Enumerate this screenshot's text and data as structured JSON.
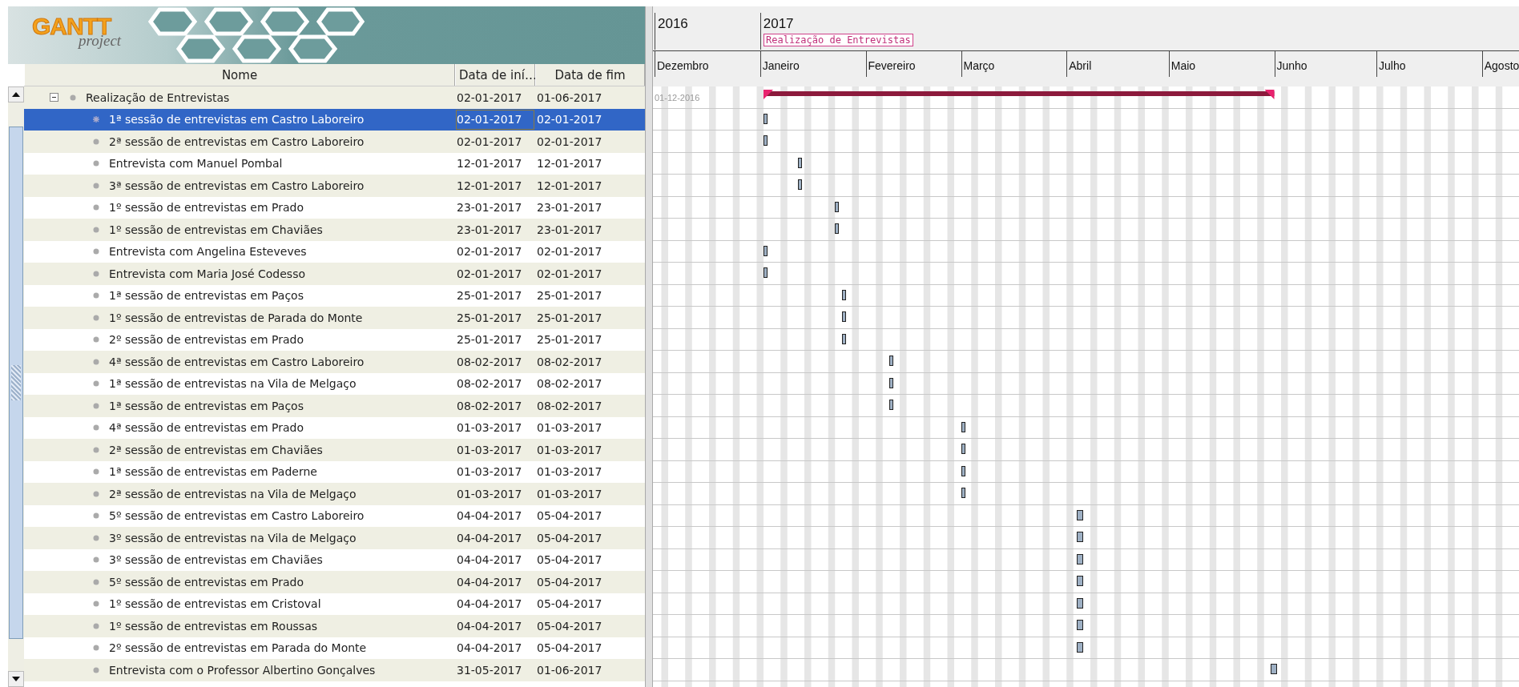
{
  "logo": {
    "wordmark": "GANTT",
    "subtitle": "project"
  },
  "table": {
    "columns": [
      "Nome",
      "Data de iní…",
      "Data de fim"
    ],
    "rows": [
      {
        "kind": "summary",
        "name": "Realização de Entrevistas",
        "start": "02-01-2017",
        "end": "01-06-2017",
        "selected": false,
        "expanded": true,
        "children": [
          {
            "kind": "task",
            "name": "1ª sessão de entrevistas em Castro Laboreiro",
            "start": "02-01-2017",
            "end": "02-01-2017",
            "selected": true
          },
          {
            "kind": "task",
            "name": "2ª sessão de entrevistas em Castro Laboreiro",
            "start": "02-01-2017",
            "end": "02-01-2017",
            "selected": false
          },
          {
            "kind": "task",
            "name": "Entrevista com Manuel Pombal",
            "start": "12-01-2017",
            "end": "12-01-2017",
            "selected": false
          },
          {
            "kind": "task",
            "name": "3ª sessão de entrevistas em Castro Laboreiro",
            "start": "12-01-2017",
            "end": "12-01-2017",
            "selected": false
          },
          {
            "kind": "task",
            "name": "1º sessão de entrevistas em Prado",
            "start": "23-01-2017",
            "end": "23-01-2017",
            "selected": false
          },
          {
            "kind": "task",
            "name": "1º sessão de entrevistas em Chaviães",
            "start": "23-01-2017",
            "end": "23-01-2017",
            "selected": false
          },
          {
            "kind": "task",
            "name": "Entrevista com Angelina Esteveves",
            "start": "02-01-2017",
            "end": "02-01-2017",
            "selected": false
          },
          {
            "kind": "task",
            "name": "Entrevista com Maria José Codesso",
            "start": "02-01-2017",
            "end": "02-01-2017",
            "selected": false
          },
          {
            "kind": "task",
            "name": "1ª sessão de entrevistas em Paços",
            "start": "25-01-2017",
            "end": "25-01-2017",
            "selected": false
          },
          {
            "kind": "task",
            "name": "1º sessão de entrevistas de Parada do Monte",
            "start": "25-01-2017",
            "end": "25-01-2017",
            "selected": false
          },
          {
            "kind": "task",
            "name": "2º sessão de entrevistas em Prado",
            "start": "25-01-2017",
            "end": "25-01-2017",
            "selected": false
          },
          {
            "kind": "task",
            "name": "4ª sessão de entrevistas em Castro Laboreiro",
            "start": "08-02-2017",
            "end": "08-02-2017",
            "selected": false
          },
          {
            "kind": "task",
            "name": "1ª sessão de entrevistas na Vila de Melgaço",
            "start": "08-02-2017",
            "end": "08-02-2017",
            "selected": false
          },
          {
            "kind": "task",
            "name": "1ª sessão de entrevistas em Paços",
            "start": "08-02-2017",
            "end": "08-02-2017",
            "selected": false
          },
          {
            "kind": "task",
            "name": "4ª sessão de entrevistas em Prado",
            "start": "01-03-2017",
            "end": "01-03-2017",
            "selected": false
          },
          {
            "kind": "task",
            "name": "2ª sessão de entrevistas em Chaviães",
            "start": "01-03-2017",
            "end": "01-03-2017",
            "selected": false
          },
          {
            "kind": "task",
            "name": "1ª sessão de entrevistas em Paderne",
            "start": "01-03-2017",
            "end": "01-03-2017",
            "selected": false
          },
          {
            "kind": "task",
            "name": "2ª sessão de entrevistas na Vila de Melgaço",
            "start": "01-03-2017",
            "end": "01-03-2017",
            "selected": false
          },
          {
            "kind": "task",
            "name": "5º sessão de entrevistas em Castro Laboreiro",
            "start": "04-04-2017",
            "end": "05-04-2017",
            "selected": false
          },
          {
            "kind": "task",
            "name": "3º sessão de entrevistas na Vila de Melgaço",
            "start": "04-04-2017",
            "end": "05-04-2017",
            "selected": false
          },
          {
            "kind": "task",
            "name": "3º sessão de entrevistas em Chaviães",
            "start": "04-04-2017",
            "end": "05-04-2017",
            "selected": false
          },
          {
            "kind": "task",
            "name": "5º sessão de entrevistas em Prado",
            "start": "04-04-2017",
            "end": "05-04-2017",
            "selected": false
          },
          {
            "kind": "task",
            "name": "1º sessão de entrevistas em Cristoval",
            "start": "04-04-2017",
            "end": "05-04-2017",
            "selected": false
          },
          {
            "kind": "task",
            "name": "1º sessão de entrevistas em Roussas",
            "start": "04-04-2017",
            "end": "05-04-2017",
            "selected": false
          },
          {
            "kind": "task",
            "name": "2º sessão de entrevistas em Parada do Monte",
            "start": "04-04-2017",
            "end": "05-04-2017",
            "selected": false
          },
          {
            "kind": "task",
            "name": "Entrevista com o Professor Albertino Gonçalves",
            "start": "31-05-2017",
            "end": "01-06-2017",
            "selected": false
          }
        ]
      }
    ]
  },
  "chart": {
    "years": [
      "2016",
      "2017"
    ],
    "months": [
      "Dezembro",
      "Janeiro",
      "Fevereiro",
      "Março",
      "Abril",
      "Maio",
      "Junho",
      "Julho",
      "Agosto"
    ],
    "start_label": "01-12-2016",
    "summary_label": "Realização de Entrevistas"
  }
}
